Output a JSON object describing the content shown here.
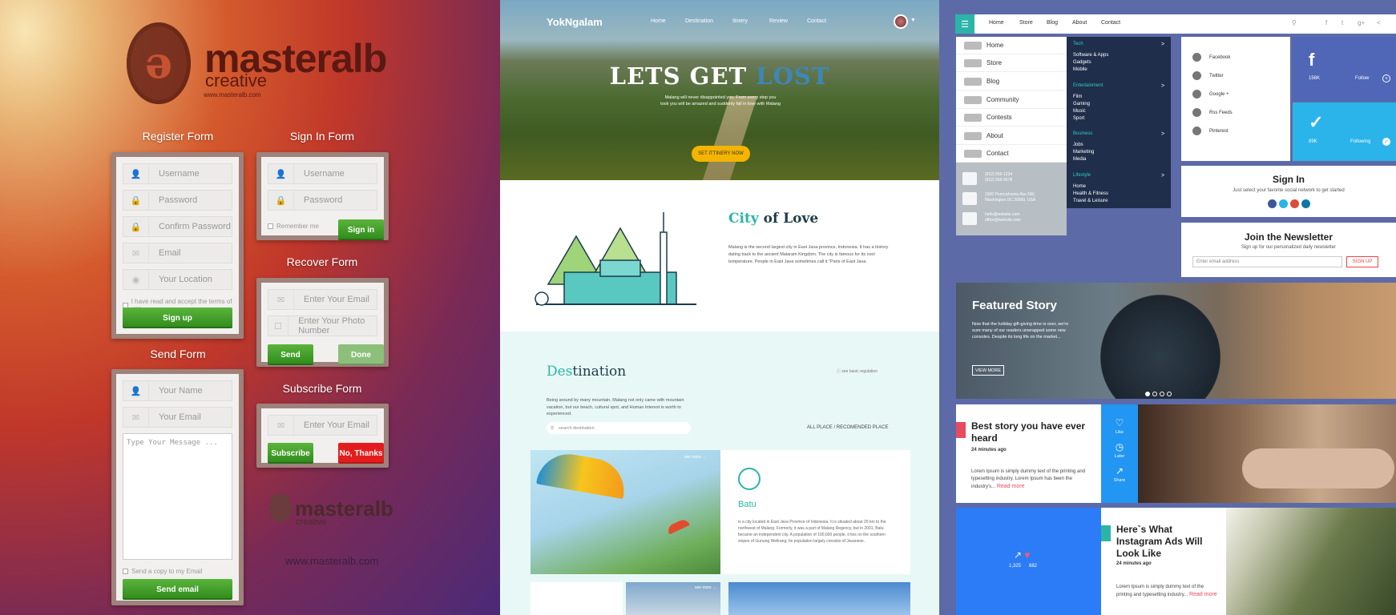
{
  "left": {
    "logo": {
      "title": "masteralb",
      "subtitle": "creative",
      "url": "www.masteralb.com"
    },
    "register": {
      "title": "Register Form",
      "fields": [
        "Username",
        "Password",
        "Confirm Password",
        "Email",
        "Your Location"
      ],
      "terms": "I have read and accept the terms of use.",
      "button": "Sign up"
    },
    "signin": {
      "title": "Sign In Form",
      "fields": [
        "Username",
        "Password"
      ],
      "remember": "Remember me",
      "button": "Sign in"
    },
    "recover": {
      "title": "Recover Form",
      "fields": [
        "Enter Your Email",
        "Enter Your Photo Number"
      ],
      "send": "Send",
      "done": "Done"
    },
    "send": {
      "title": "Send Form",
      "fields": [
        "Your Name",
        "Your Email"
      ],
      "message": "Type Your Message ...",
      "copy": "Send a copy to my Email",
      "button": "Send email"
    },
    "subscribe": {
      "title": "Subscribe Form",
      "field": "Enter Your Email",
      "subscribe": "Subscribe",
      "no": "No, Thanks"
    },
    "logo2": {
      "title": "masteralb",
      "subtitle": "creative",
      "url": "www.masteralb.com"
    }
  },
  "middle": {
    "brand": "YokNgalam",
    "nav": [
      "Home",
      "Destination",
      "Itinery",
      "Review",
      "Contact"
    ],
    "hero": {
      "title_a": "LETS GET ",
      "title_b": "LOST",
      "text": "Malang will never disappointed you. From every step you took you will be amazed and suddenly fall in love with Malang",
      "button": "SET ITTINERY NOW"
    },
    "city": {
      "title_a": "City ",
      "title_b": "of Love",
      "text": "Malang is the second largest city in East Java province, Indonesia. It has a history dating back to the ancient Malaram Kingdom. The city is famous for its cool temperature. People in East Java sometimes call it \"Paris of East Java."
    },
    "destination": {
      "title_a": "Des",
      "title_b": "tination",
      "note": "see basic regulation",
      "text": "Being around by many mountain, Malang not only came with mountain vacation, but our beach, cultural spot, and Human Interest is worth to experienced.",
      "search": "search destination",
      "filter": "ALL PLACE / RECOMENDED PLACE",
      "see_more": "see more",
      "card": {
        "name": "Batu",
        "desc": "is a city located in East Java Province of Indonesia. It is situated about 20 km to the northwest of Malang. Formerly, it was a part of Malang Regency, but in 2001, Batu became an independent city. A population of 190,000 people, it lies on the southern slopes of Gunung Welirang. Its population largely consists of Javanese."
      }
    }
  },
  "right": {
    "topnav": [
      "Home",
      "Store",
      "Blog",
      "About",
      "Contact"
    ],
    "menu": [
      "Home",
      "Store",
      "Blog",
      "Community",
      "Contests",
      "About",
      "Contact"
    ],
    "contact": {
      "phone": [
        "(912) 555-1234",
        "(912) 555-5678"
      ],
      "address": [
        "1600 Pennsylvania Ave NW,",
        "Washington DC 20500, USA"
      ],
      "email": [
        "hello@website.com",
        "office@website.com"
      ]
    },
    "submenu": [
      {
        "head": "Tech",
        "items": [
          "Software & Apps",
          "Gadgets",
          "Mobile"
        ]
      },
      {
        "head": "Entertainment",
        "items": [
          "Film",
          "Gaming",
          "Music",
          "Sport"
        ]
      },
      {
        "head": "Business",
        "items": [
          "Jobs",
          "Marketing",
          "Media"
        ]
      },
      {
        "head": "Lifestyle",
        "items": [
          "Home",
          "Health & Fitness",
          "Travel & Leisure"
        ]
      }
    ],
    "social": [
      "Facebook",
      "Twitter",
      "Google +",
      "Rss Feeds",
      "Pinterest"
    ],
    "fb": {
      "icon": "f",
      "count": "156K",
      "label": "Follow"
    },
    "tw": {
      "count": "89K",
      "label": "Following"
    },
    "signin": {
      "title": "Sign In",
      "text": "Just select your favorite social network to get started"
    },
    "newsletter": {
      "title": "Join the Newsletter",
      "text": "Sign up for our personalized daily newsletter",
      "placeholder": "Enter email address",
      "button": "SIGN UP"
    },
    "featured": {
      "title": "Featured Story",
      "text": "Now that the holiday gift-giving time is over, we're sure many of our readers unwrapped some new consoles. Despite its long life on the market...",
      "button": "VIEW MORE"
    },
    "story": {
      "title": "Best story you have ever heard",
      "time": "24 minutes ago",
      "text": "Lorem Ipsum is simply dummy text of the printing and typesetting industry. Lorem Ipsum has been the industry's...",
      "more": "Read more"
    },
    "actions": [
      "Like",
      "Later",
      "Share"
    ],
    "counts": {
      "shares": "1,325",
      "likes": "682"
    },
    "insta": {
      "title": "Here`s What Instagram Ads Will Look Like",
      "time": "24 minutes ago",
      "text": "Lorem Ipsum is simply dummy text of the printing and typesetting industry...",
      "more": "Read more"
    }
  }
}
